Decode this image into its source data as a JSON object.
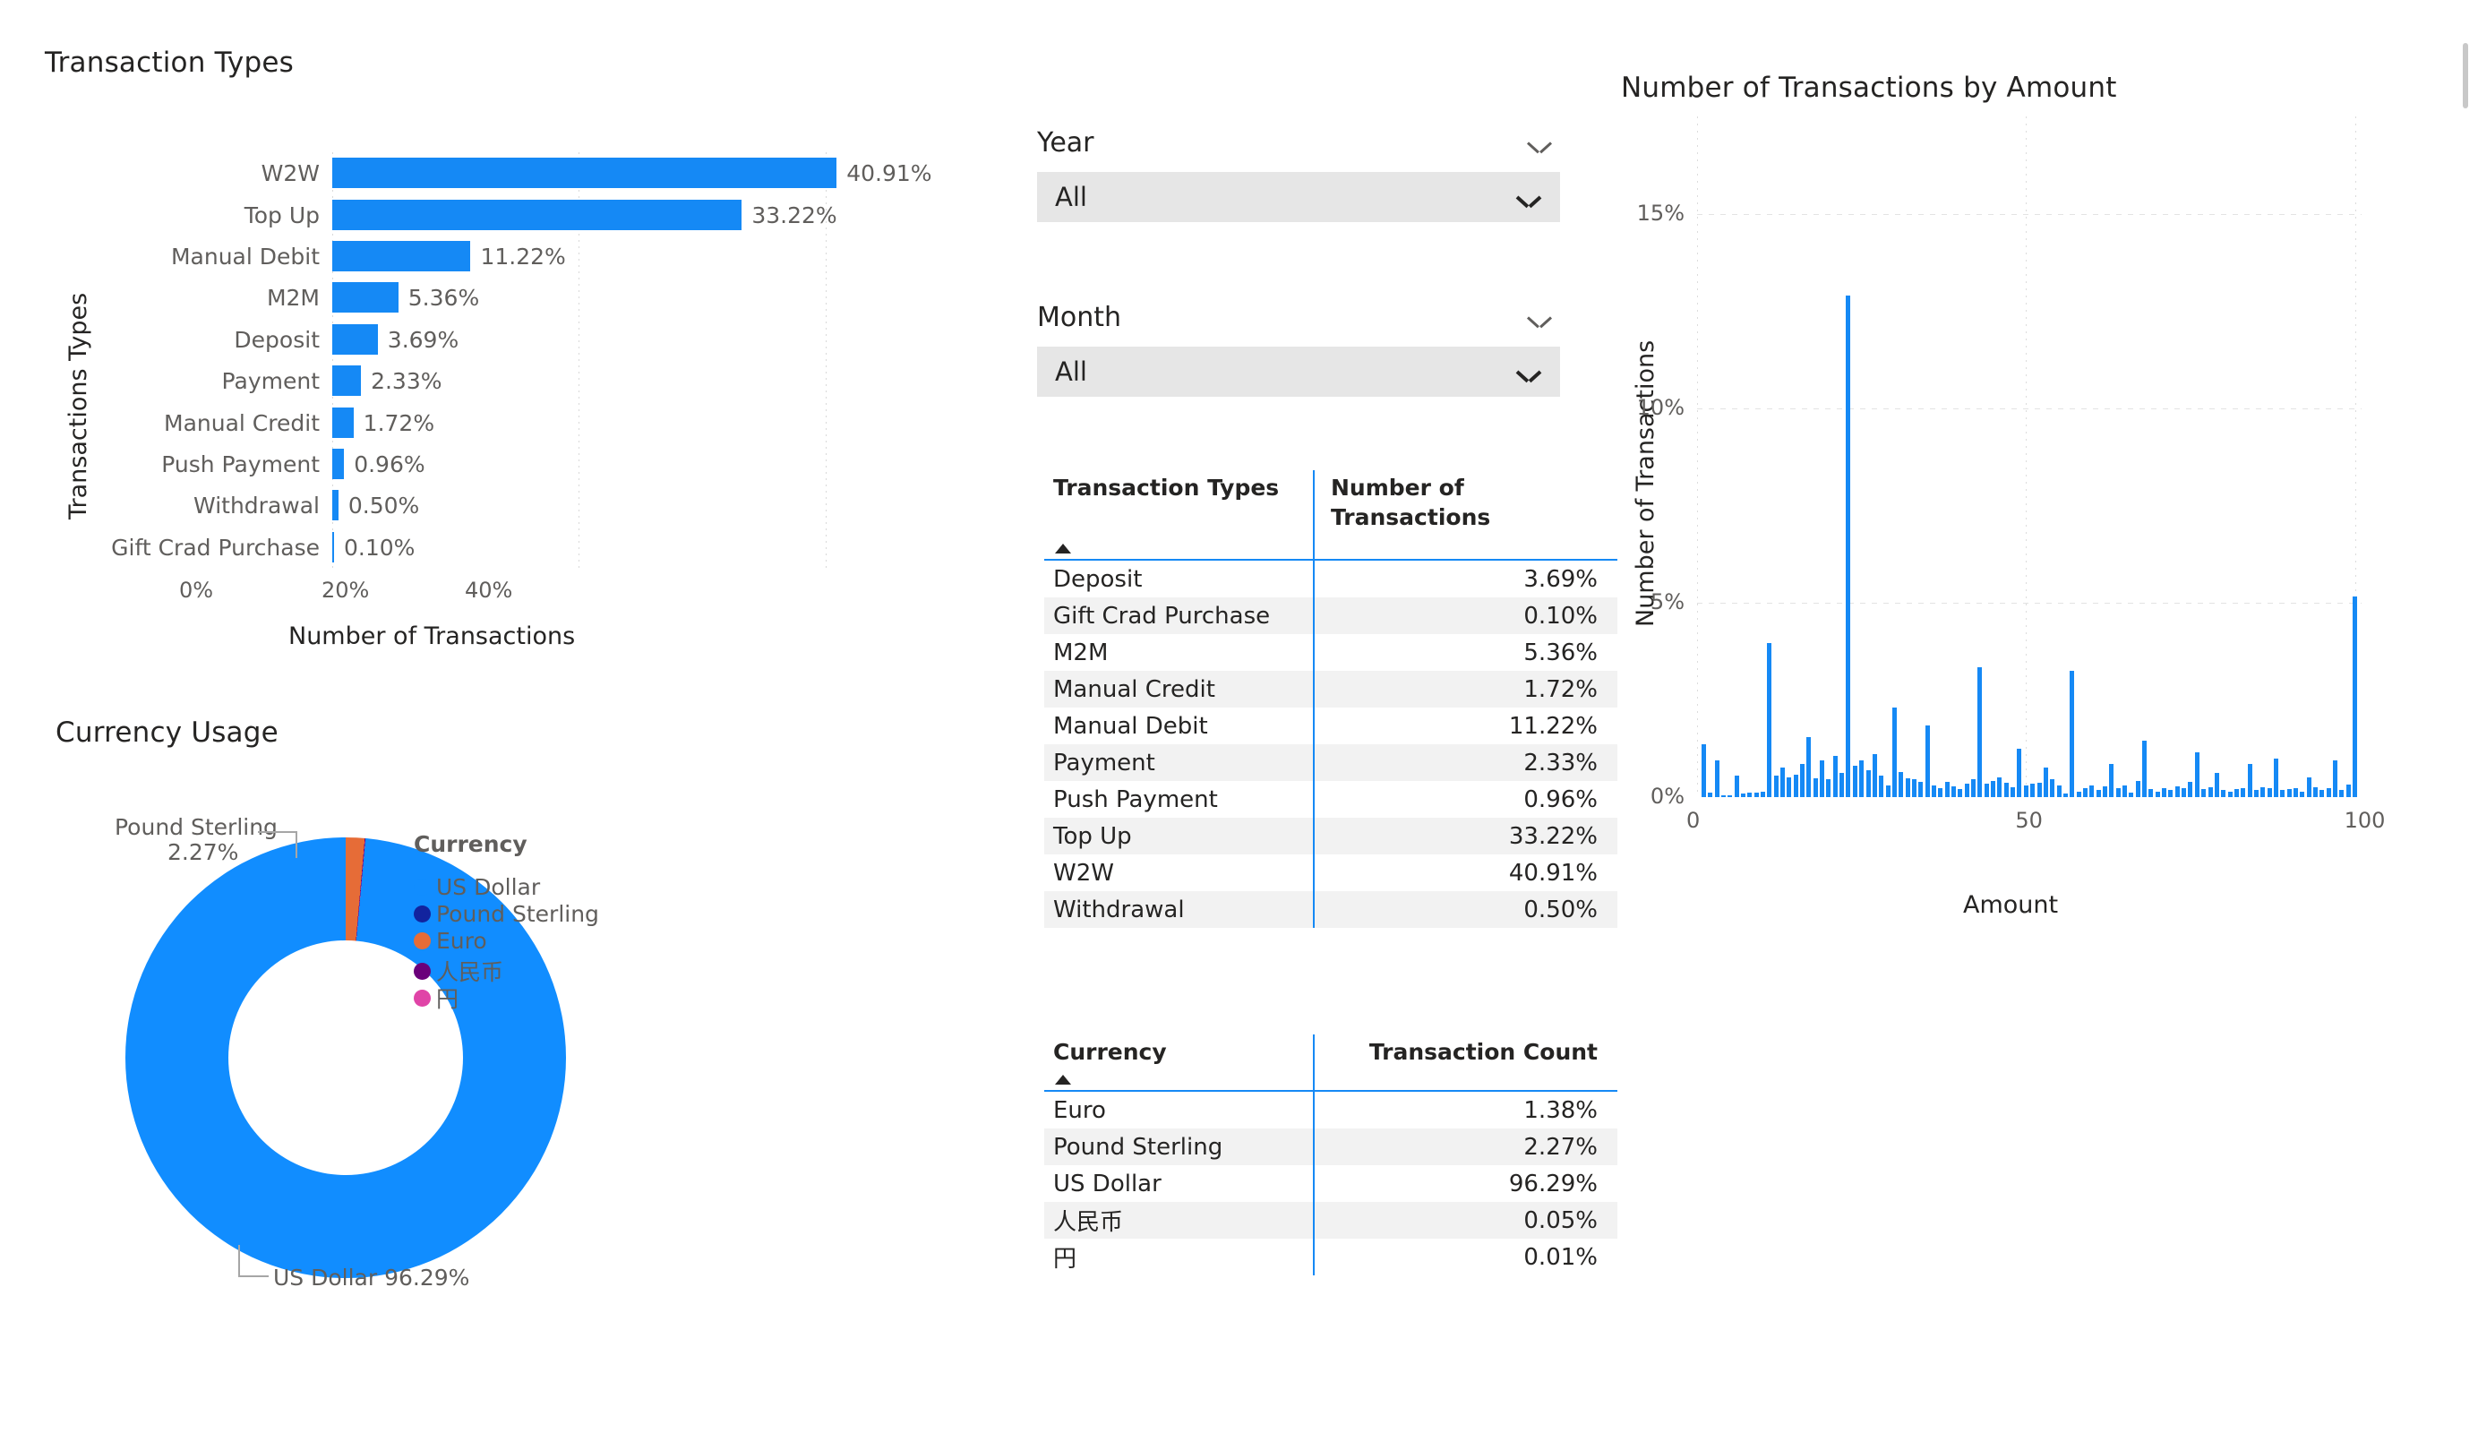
{
  "bar_chart": {
    "title": "Transaction Types",
    "y_axis_title": "Transactions Types",
    "x_axis_title": "Number of Transactions",
    "x_ticks": [
      "0%",
      "20%",
      "40%"
    ],
    "accent_color": "#1589F5"
  },
  "donut_chart": {
    "title": "Currency Usage",
    "legend_title": "Currency",
    "callout_1_name": "Pound Sterling",
    "callout_1_value": "2.27%",
    "callout_2": "US Dollar 96.29%",
    "legend": [
      {
        "label": "US Dollar",
        "color": "#118DFF"
      },
      {
        "label": "Pound Sterling",
        "color": "#12239E"
      },
      {
        "label": "Euro",
        "color": "#E66C37"
      },
      {
        "label": "人民币",
        "color": "#6B007B"
      },
      {
        "label": "円",
        "color": "#E044A7"
      }
    ]
  },
  "slicers": [
    {
      "label": "Year",
      "value": "All",
      "icon": "chevron-down-icon"
    },
    {
      "label": "Month",
      "value": "All",
      "icon": "chevron-down-icon"
    }
  ],
  "transaction_table": {
    "columns": [
      "Transaction Types",
      "Number of Transactions"
    ],
    "sort_column": "Transaction Types",
    "sort_direction": "ascending",
    "rows": [
      [
        "Deposit",
        "3.69%"
      ],
      [
        "Gift Crad Purchase",
        "0.10%"
      ],
      [
        "M2M",
        "5.36%"
      ],
      [
        "Manual Credit",
        "1.72%"
      ],
      [
        "Manual Debit",
        "11.22%"
      ],
      [
        "Payment",
        "2.33%"
      ],
      [
        "Push Payment",
        "0.96%"
      ],
      [
        "Top Up",
        "33.22%"
      ],
      [
        "W2W",
        "40.91%"
      ],
      [
        "Withdrawal",
        "0.50%"
      ]
    ]
  },
  "currency_table": {
    "columns": [
      "Currency",
      "Transaction Count"
    ],
    "sort_column": "Currency",
    "sort_direction": "ascending",
    "rows": [
      [
        "Euro",
        "1.38%"
      ],
      [
        "Pound Sterling",
        "2.27%"
      ],
      [
        "US Dollar",
        "96.29%"
      ],
      [
        "人民币",
        "0.05%"
      ],
      [
        "円",
        "0.01%"
      ]
    ]
  },
  "histogram": {
    "title": "Number of Transactions by Amount",
    "y_axis_title": "Number of Transactions",
    "x_axis_title": "Amount",
    "y_ticks": [
      "0%",
      "5%",
      "10%",
      "15%"
    ],
    "x_ticks": [
      "0",
      "50",
      "100"
    ]
  },
  "chart_data": [
    {
      "type": "bar",
      "orientation": "horizontal",
      "title": "Transaction Types",
      "xlabel": "Number of Transactions",
      "ylabel": "Transactions Types",
      "xlim": [
        0,
        43
      ],
      "xticks": [
        0,
        20,
        40
      ],
      "xtick_labels": [
        "0%",
        "20%",
        "40%"
      ],
      "grid": true,
      "unit": "%",
      "color": "#1589F5",
      "categories": [
        "W2W",
        "Top Up",
        "Manual Debit",
        "M2M",
        "Deposit",
        "Payment",
        "Manual Credit",
        "Push Payment",
        "Withdrawal",
        "Gift Crad Purchase"
      ],
      "values": [
        40.91,
        33.22,
        11.22,
        5.36,
        3.69,
        2.33,
        1.72,
        0.96,
        0.5,
        0.1
      ],
      "data_labels": [
        "40.91%",
        "33.22%",
        "11.22%",
        "5.36%",
        "3.69%",
        "2.33%",
        "1.72%",
        "0.96%",
        "0.50%",
        "0.10%"
      ]
    },
    {
      "type": "pie",
      "subtype": "donut",
      "title": "Currency Usage",
      "legend_title": "Currency",
      "legend_position": "right",
      "unit": "%",
      "labels": [
        "US Dollar",
        "Pound Sterling",
        "Euro",
        "人民币",
        "円"
      ],
      "values": [
        96.29,
        2.27,
        1.38,
        0.05,
        0.01
      ],
      "colors": [
        "#118DFF",
        "#12239E",
        "#E66C37",
        "#6B007B",
        "#E044A7"
      ],
      "annotations": [
        "Pound Sterling 2.27%",
        "US Dollar 96.29%"
      ]
    },
    {
      "type": "bar",
      "subtype": "histogram",
      "title": "Number of Transactions by Amount",
      "xlabel": "Amount",
      "ylabel": "Number of Transactions",
      "xlim": [
        0,
        101
      ],
      "ylim": [
        0,
        17.5
      ],
      "xticks": [
        0,
        50,
        100
      ],
      "yticks": [
        0,
        5,
        10,
        15
      ],
      "ytick_labels": [
        "0%",
        "5%",
        "10%",
        "15%"
      ],
      "grid": true,
      "unit": "%",
      "color": "#1589F5",
      "x": [
        1,
        2,
        3,
        4,
        5,
        6,
        7,
        8,
        9,
        10,
        11,
        12,
        13,
        14,
        15,
        16,
        17,
        18,
        19,
        20,
        21,
        22,
        23,
        24,
        25,
        26,
        27,
        28,
        29,
        30,
        31,
        32,
        33,
        34,
        35,
        36,
        37,
        38,
        39,
        40,
        41,
        42,
        43,
        44,
        45,
        46,
        47,
        48,
        49,
        50,
        51,
        52,
        53,
        54,
        55,
        56,
        57,
        58,
        59,
        60,
        61,
        62,
        63,
        64,
        65,
        66,
        67,
        68,
        69,
        70,
        71,
        72,
        73,
        74,
        75,
        76,
        77,
        78,
        79,
        80,
        81,
        82,
        83,
        84,
        85,
        86,
        87,
        88,
        89,
        90,
        91,
        92,
        93,
        94,
        95,
        96,
        97,
        98,
        99,
        100
      ],
      "values": [
        1.35,
        0.12,
        0.95,
        0.05,
        0.05,
        0.55,
        0.1,
        0.12,
        0.12,
        0.15,
        3.95,
        0.55,
        0.75,
        0.5,
        0.58,
        0.85,
        1.55,
        0.48,
        0.95,
        0.45,
        1.05,
        0.62,
        12.9,
        0.8,
        0.95,
        0.7,
        1.1,
        0.55,
        0.3,
        2.3,
        0.65,
        0.48,
        0.45,
        0.4,
        1.85,
        0.3,
        0.22,
        0.4,
        0.28,
        0.2,
        0.35,
        0.45,
        3.35,
        0.35,
        0.42,
        0.5,
        0.38,
        0.25,
        1.25,
        0.3,
        0.35,
        0.38,
        0.75,
        0.45,
        0.3,
        0.1,
        3.25,
        0.15,
        0.22,
        0.3,
        0.18,
        0.28,
        0.85,
        0.22,
        0.3,
        0.12,
        0.42,
        1.45,
        0.2,
        0.15,
        0.22,
        0.18,
        0.28,
        0.22,
        0.4,
        1.15,
        0.2,
        0.25,
        0.62,
        0.18,
        0.15,
        0.2,
        0.22,
        0.85,
        0.18,
        0.25,
        0.22,
        0.98,
        0.18,
        0.2,
        0.22,
        0.15,
        0.5,
        0.25,
        0.18,
        0.22,
        0.95,
        0.18,
        0.32,
        5.15
      ]
    }
  ]
}
